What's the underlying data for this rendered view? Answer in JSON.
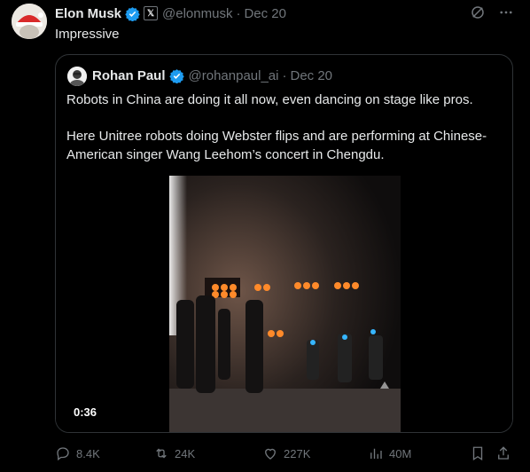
{
  "tweet": {
    "author_name": "Elon Musk",
    "handle": "@elonmusk",
    "separator": "·",
    "date": "Dec 20",
    "text": "Impressive",
    "x_badge": "𝕏"
  },
  "quote": {
    "author_name": "Rohan Paul",
    "handle": "@rohanpaul_ai",
    "separator": "·",
    "date": "Dec 20",
    "paragraph1": "Robots in China are doing it all now, even dancing on stage like pros.",
    "paragraph2": "Here Unitree robots doing Webster flips and are performing at Chinese-American singer Wang Leehom’s concert in Chengdu.",
    "video_duration": "0:36"
  },
  "actions": {
    "replies": "8.4K",
    "reposts": "24K",
    "likes": "227K",
    "views": "40M"
  },
  "colors": {
    "background": "#000000",
    "text": "#e7e9ea",
    "muted": "#71767b",
    "verified": "#1d9bf0",
    "border": "#2f3336"
  }
}
